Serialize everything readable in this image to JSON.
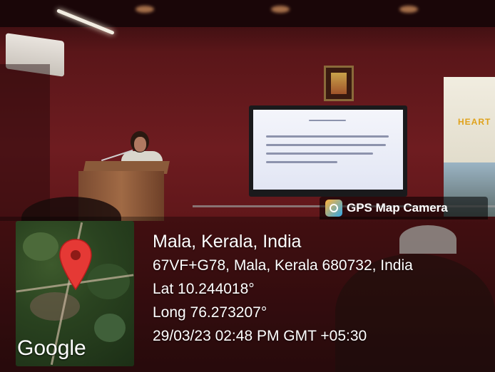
{
  "overlay": {
    "camera_badge": "GPS Map Camera",
    "camera_icon": "camera-app-icon",
    "map_brand": "Google",
    "map_pin_icon": "map-pin-icon",
    "location_title": "Mala, Kerala, India",
    "address": "67VF+G78, Mala, Kerala 680732, India",
    "latitude": "Lat 10.244018°",
    "longitude": "Long 76.273207°",
    "datetime": "29/03/23 02:48 PM GMT +05:30"
  },
  "scene": {
    "banner_text": "HEART"
  },
  "colors": {
    "pin": "#e53935",
    "pin_dot": "#8e1b17",
    "overlay_text": "#ffffff"
  }
}
